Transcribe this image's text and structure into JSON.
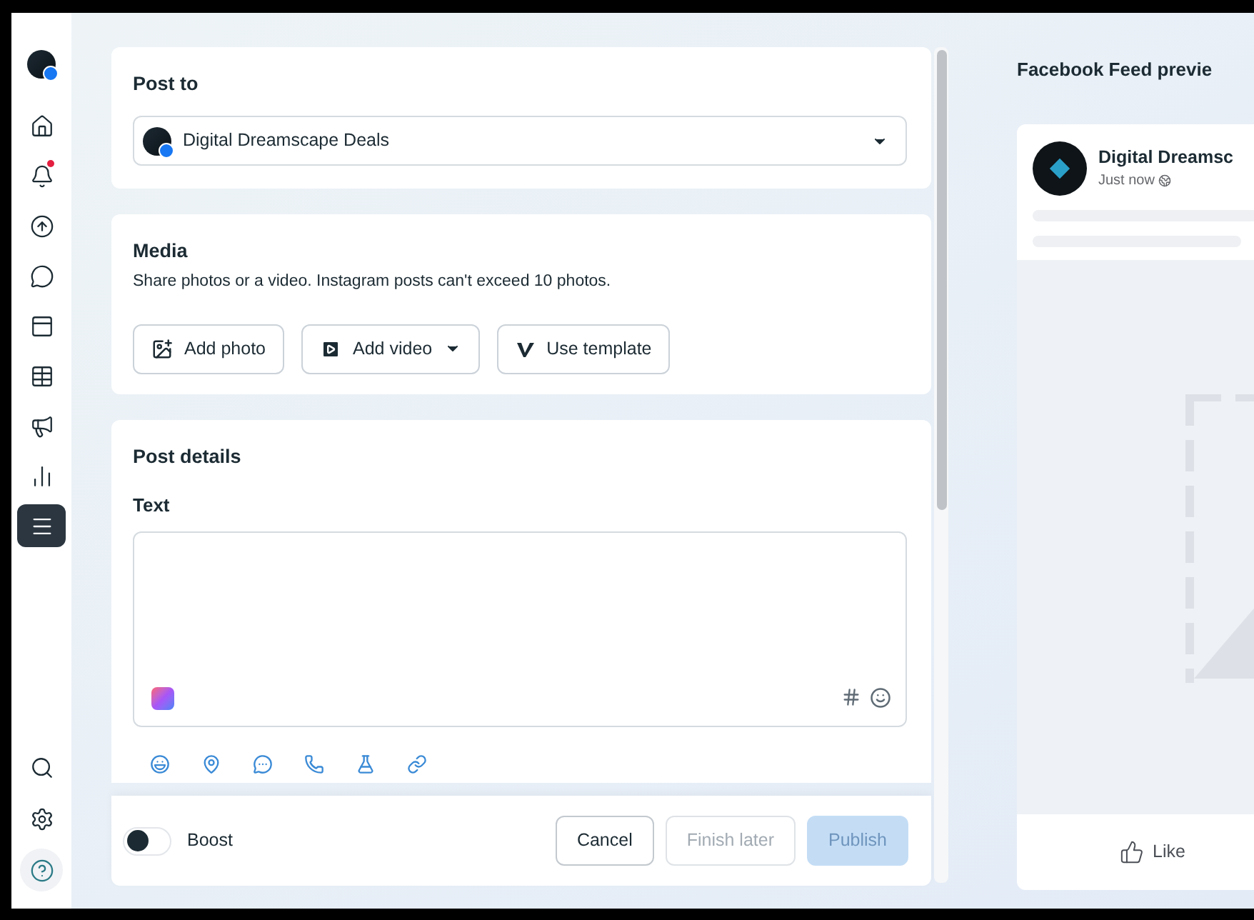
{
  "sidebar": {
    "items": [
      {
        "kind": "home",
        "selected": false,
        "dot": false
      },
      {
        "kind": "bell",
        "selected": false,
        "dot": true
      },
      {
        "kind": "circle-up",
        "selected": false,
        "dot": false
      },
      {
        "kind": "chat",
        "selected": false,
        "dot": false
      },
      {
        "kind": "pages",
        "selected": false,
        "dot": false
      },
      {
        "kind": "table",
        "selected": false,
        "dot": false
      },
      {
        "kind": "megaphone",
        "selected": false,
        "dot": false
      },
      {
        "kind": "chart",
        "selected": false,
        "dot": false
      },
      {
        "kind": "menu",
        "selected": true,
        "dot": false
      }
    ],
    "bottom_items": [
      {
        "kind": "search"
      },
      {
        "kind": "settings"
      },
      {
        "kind": "help"
      }
    ]
  },
  "post_to": {
    "title": "Post to",
    "account": "Digital Dreamscape Deals"
  },
  "media": {
    "title": "Media",
    "description": "Share photos or a video. Instagram posts can't exceed 10 photos.",
    "buttons": [
      {
        "kind": "photo",
        "label": "Add photo",
        "dropdown": false
      },
      {
        "kind": "video",
        "label": "Add video",
        "dropdown": true
      },
      {
        "kind": "template",
        "label": "Use template",
        "dropdown": false
      }
    ]
  },
  "post_details": {
    "title": "Post details",
    "text_label": "Text",
    "tools": [
      {
        "kind": "face"
      },
      {
        "kind": "pin"
      },
      {
        "kind": "messenger"
      },
      {
        "kind": "whatsapp"
      },
      {
        "kind": "flask"
      },
      {
        "kind": "link"
      }
    ]
  },
  "footer": {
    "boost": {
      "label": "Boost",
      "on": false
    },
    "buttons": [
      {
        "kind": "secondary",
        "label": "Cancel",
        "disabled": false
      },
      {
        "kind": "secondary",
        "label": "Finish later",
        "disabled": true
      },
      {
        "kind": "primary",
        "label": "Publish",
        "disabled": true
      }
    ]
  },
  "preview": {
    "title": "Facebook Feed previe",
    "page_name": "Digital Dreamsc",
    "time": "Just now",
    "like": "Like"
  }
}
